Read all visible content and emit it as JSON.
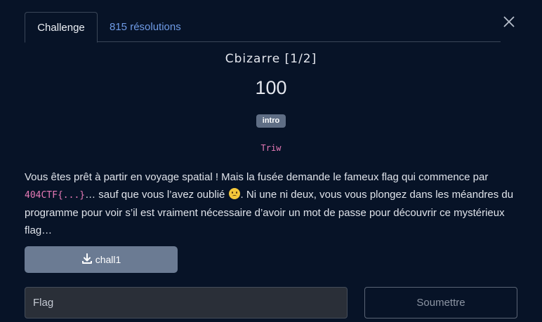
{
  "tabs": [
    {
      "label": "Challenge",
      "active": true
    },
    {
      "label": "815 résolutions",
      "active": false
    }
  ],
  "challenge": {
    "title": "Cbizarre [1/2]",
    "points": "100",
    "tag": "intro",
    "author": "Triw"
  },
  "description": {
    "part1": "Vous êtes prêt à partir en voyage spatial ! Mais la fusée demande le fameux flag qui commence par ",
    "code": "404CTF{...}",
    "part2": "… sauf que vous l’avez oublié ",
    "emoji": "worried-face-icon",
    "part3": ". Ni une ni deux, vous vous plongez dans les méandres du programme pour voir s’il est vraiment nécessaire d’avoir un mot de passe pour découvrir ce mystérieux flag…"
  },
  "download": {
    "label": "chall1",
    "icon": "download-icon"
  },
  "form": {
    "flag_placeholder": "Flag",
    "flag_value": "",
    "submit_label": "Soumettre"
  },
  "colors": {
    "background": "#071327",
    "tab_link": "#6f9be6",
    "code": "#e77ab7",
    "tag": "#5f6e85",
    "download_button": "#6b7b93"
  }
}
